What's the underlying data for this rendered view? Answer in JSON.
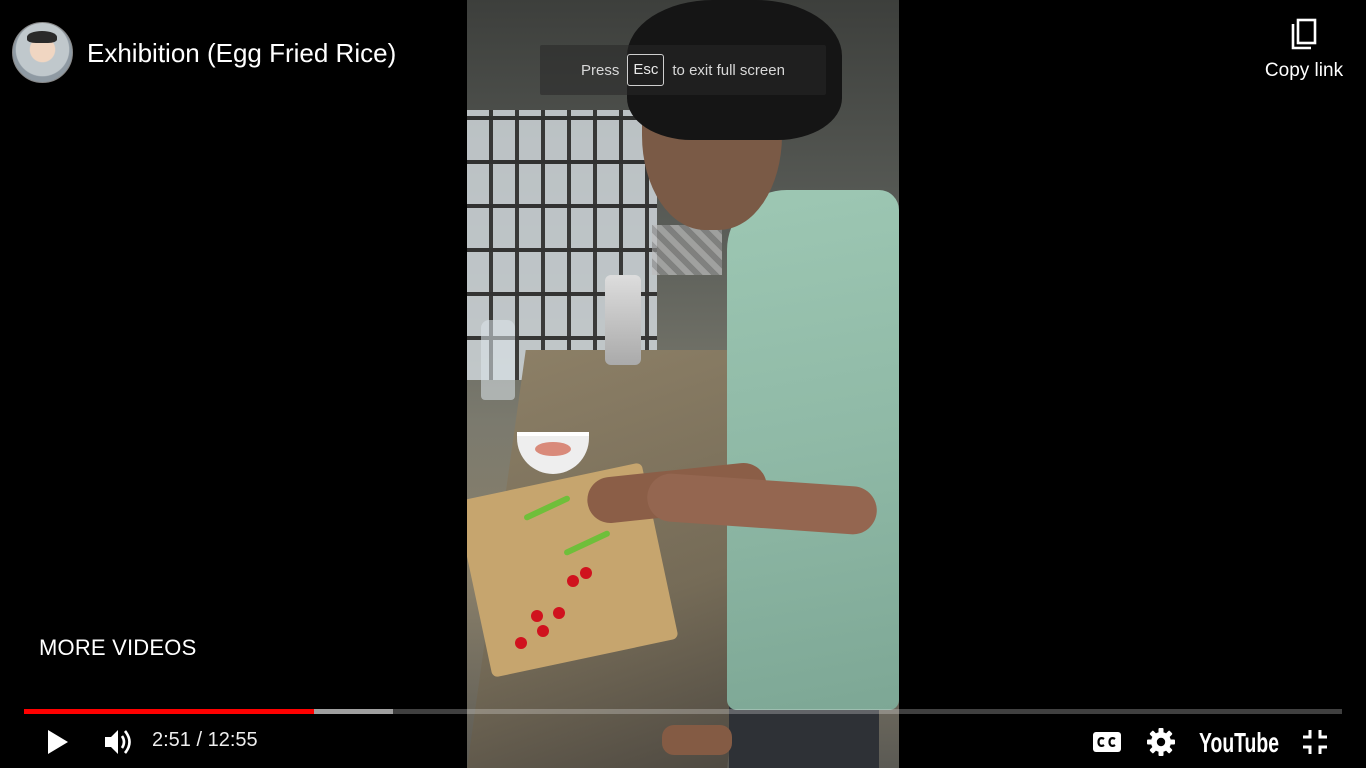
{
  "player": {
    "title": "Exhibition (Egg Fried Rice)",
    "channel_avatar_icon": "channel-avatar",
    "copy_link_label": "Copy link",
    "fullscreen_hint": {
      "before": "Press",
      "key": "Esc",
      "after": "to exit full screen"
    },
    "more_videos_label": "MORE VIDEOS",
    "time": {
      "current": "2:51",
      "separator": "/",
      "duration": "12:55"
    },
    "progress": {
      "played_fraction": 0.22,
      "buffered_fraction": 0.28
    },
    "brand_label": "YouTube",
    "accent_color": "#ff0000",
    "icons": [
      "play-icon",
      "volume-icon",
      "captions-icon",
      "settings-icon",
      "exit-fullscreen-icon",
      "copy-icon"
    ]
  }
}
